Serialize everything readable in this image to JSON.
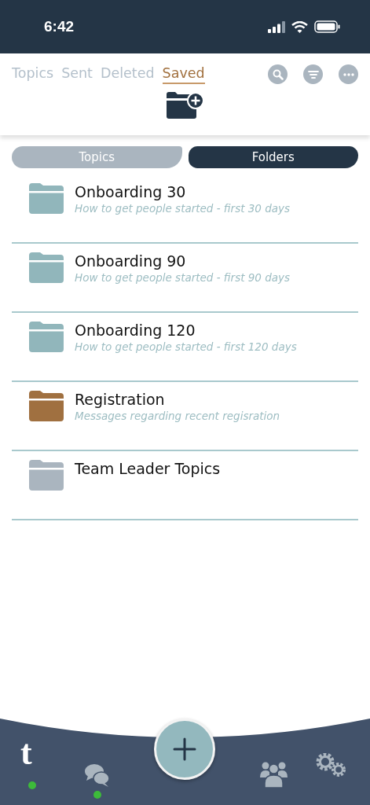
{
  "status_bar": {
    "time": "6:42"
  },
  "tabs": [
    {
      "label": "Topics",
      "selected": false
    },
    {
      "label": "Sent",
      "selected": false
    },
    {
      "label": "Deleted",
      "selected": false
    },
    {
      "label": "Saved",
      "selected": true
    }
  ],
  "segments": [
    {
      "label": "Topics",
      "selected": false
    },
    {
      "label": "Folders",
      "selected": true
    }
  ],
  "folders": [
    {
      "name": "Onboarding 30",
      "description": "How to get people started - first 30 days",
      "color": "#91b6bb"
    },
    {
      "name": "Onboarding 90",
      "description": "How to get people started - first 90 days",
      "color": "#91b6bb"
    },
    {
      "name": "Onboarding 120",
      "description": "How to get people started - first 120 days",
      "color": "#91b6bb"
    },
    {
      "name": "Registration",
      "description": "Messages regarding recent regisration",
      "color": "#a07040"
    },
    {
      "name": "Team Leader Topics",
      "color": "#aab5bf"
    }
  ],
  "tab_bar": {
    "logo": "t",
    "items": [
      {
        "kind": "home",
        "unread": true
      },
      {
        "kind": "chat",
        "unread": true
      },
      {
        "kind": "compose",
        "unread": false
      },
      {
        "kind": "people",
        "unread": false
      },
      {
        "kind": "settings",
        "unread": false
      }
    ]
  }
}
